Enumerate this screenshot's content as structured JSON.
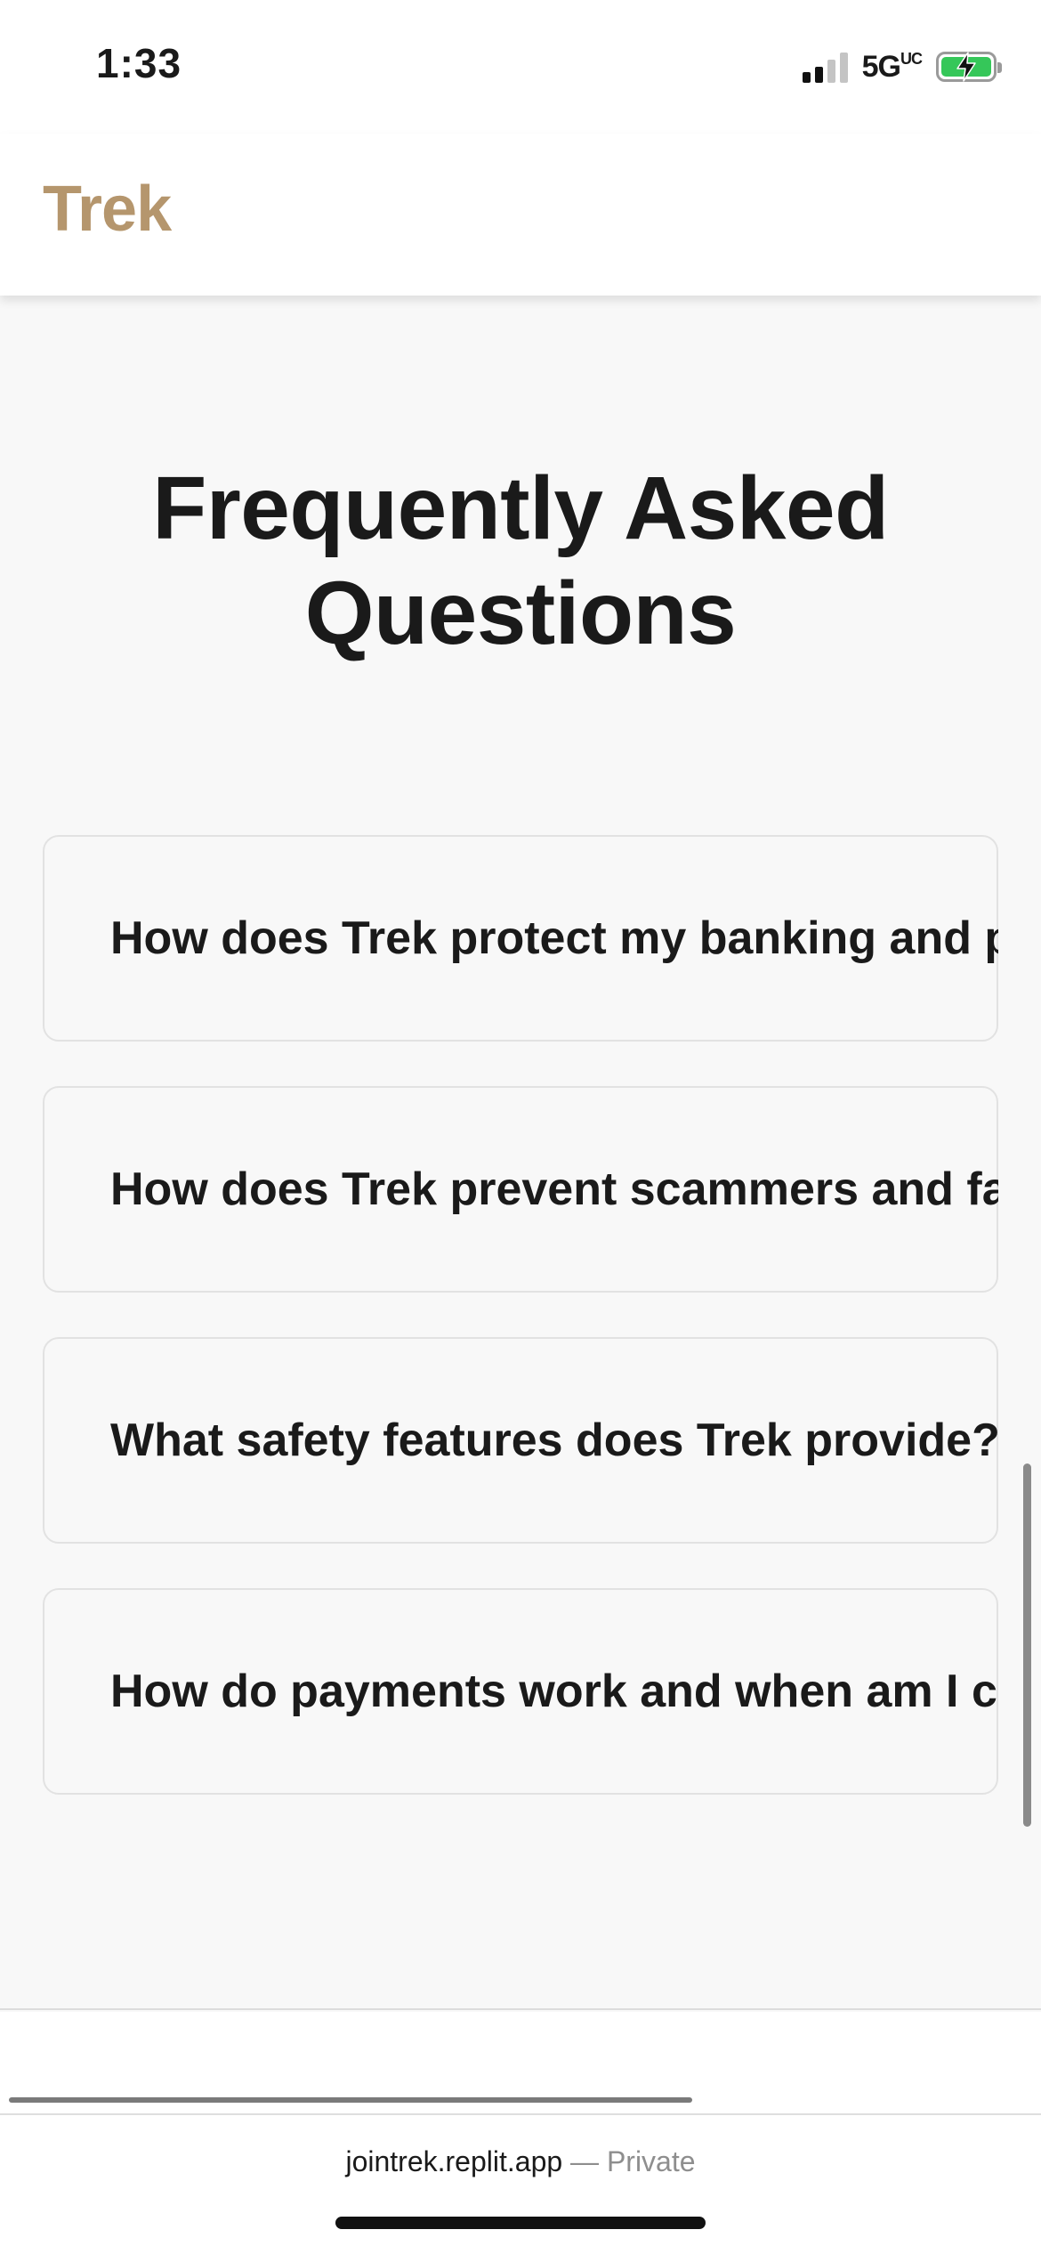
{
  "status_bar": {
    "time": "1:33",
    "network": "5G",
    "network_suffix": "UC",
    "battery_color": "#35c759"
  },
  "header": {
    "brand": "Trek",
    "brand_color": "#b5966d"
  },
  "faq": {
    "title": "Frequently Asked Questions",
    "items": [
      {
        "question": "How does Trek protect my banking and pe"
      },
      {
        "question": "How does Trek prevent scammers and fak"
      },
      {
        "question": "What safety features does Trek provide?"
      },
      {
        "question": "How do payments work and when am I cha"
      }
    ]
  },
  "browser": {
    "url": "jointrek.replit.app",
    "separator": "—",
    "privacy": "Private"
  },
  "icons": {
    "signal": "cellular-signal-icon",
    "battery": "battery-charging-icon"
  }
}
